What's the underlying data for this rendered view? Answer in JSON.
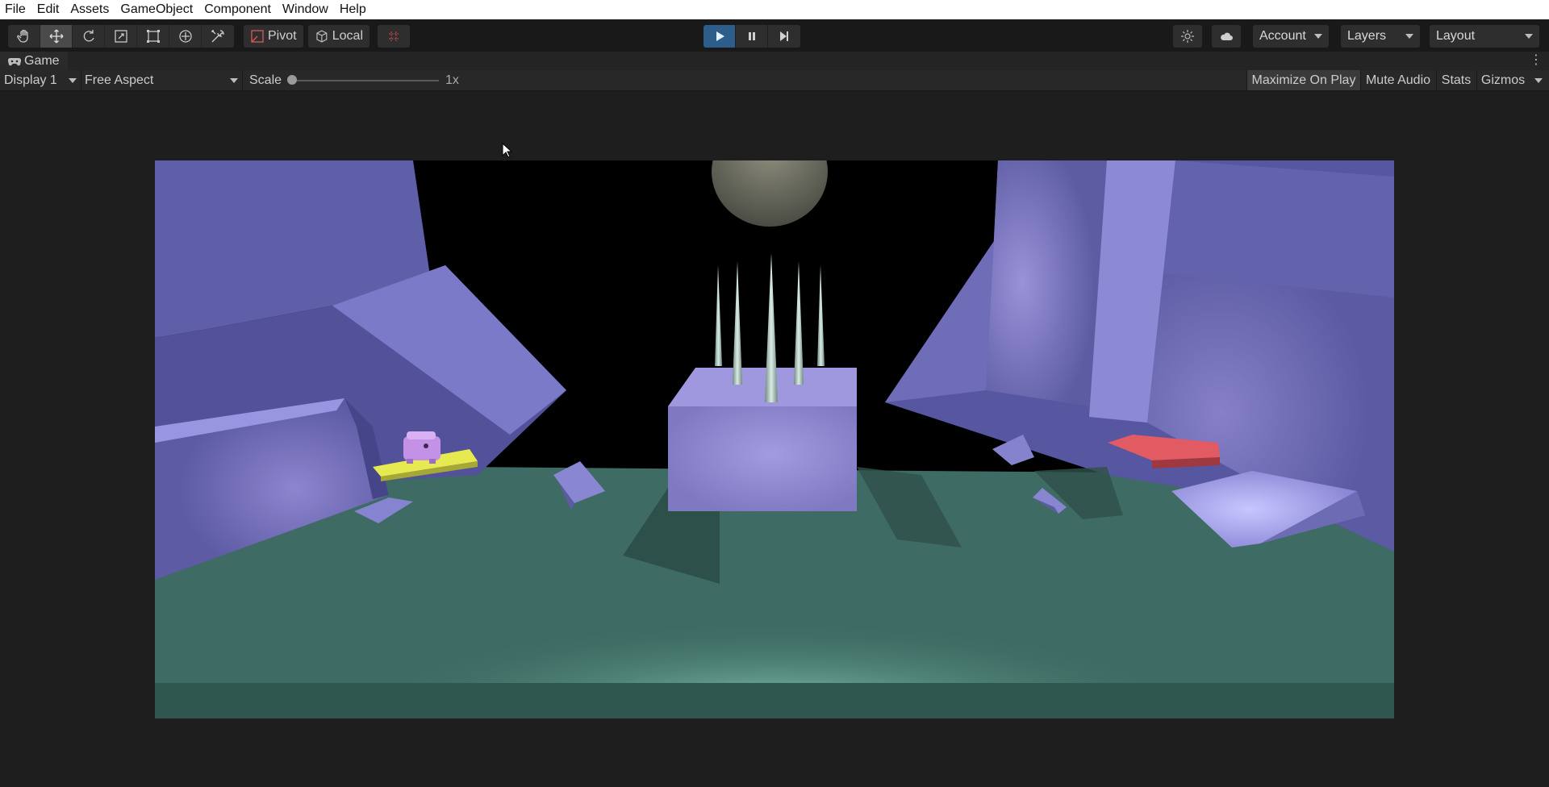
{
  "menu": [
    "File",
    "Edit",
    "Assets",
    "GameObject",
    "Component",
    "Window",
    "Help"
  ],
  "toolbar": {
    "tools": [
      "hand-tool",
      "move-tool",
      "rotate-tool",
      "scale-tool",
      "rect-tool",
      "transform-tool",
      "custom-tool"
    ],
    "active_tool": "move-tool",
    "pivot_label": "Pivot",
    "local_label": "Local",
    "playing": true,
    "account_label": "Account",
    "layers_label": "Layers",
    "layout_label": "Layout"
  },
  "tab": {
    "label": "Game"
  },
  "gamebar": {
    "display": "Display 1",
    "aspect": "Free Aspect",
    "scale_label": "Scale",
    "scale_value": "1x",
    "maximize": "Maximize On Play",
    "mute": "Mute Audio",
    "stats": "Stats",
    "gizmos": "Gizmos"
  },
  "colors": {
    "play_active": "#2d5d8a",
    "rock": "#7a78c4",
    "floor": "#3f6a62",
    "yellow_pad": "#e8ea52",
    "red_pad": "#e0505a"
  }
}
